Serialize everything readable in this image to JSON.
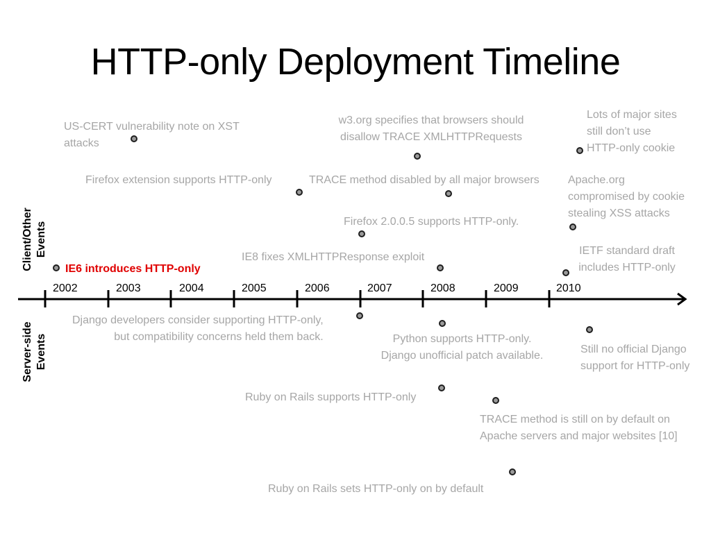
{
  "title": "HTTP-only Deployment Timeline",
  "side_labels": {
    "top": [
      "Client/Other",
      "Events"
    ],
    "bottom": [
      "Server-side",
      "Events"
    ]
  },
  "axis": {
    "years": [
      "2002",
      "2003",
      "2004",
      "2005",
      "2006",
      "2007",
      "2008",
      "2009",
      "2010"
    ]
  },
  "colors": {
    "highlight": "#e00000",
    "event_text": "#a6a6a6",
    "axis": "#000000"
  },
  "client_events": [
    {
      "text": [
        "US-CERT vulnerability note on XST",
        "attacks"
      ]
    },
    {
      "text": [
        "w3.org  specifies that browsers should",
        "disallow TRACE XMLHTTPRequests"
      ]
    },
    {
      "text": [
        "Lots of major sites",
        "still don’t use",
        "HTTP-only cookie"
      ]
    },
    {
      "text": [
        "Firefox extension supports HTTP-only"
      ]
    },
    {
      "text": [
        "TRACE method disabled by all major browsers"
      ]
    },
    {
      "text": [
        "Apache.org",
        "compromised by cookie",
        "stealing XSS attacks"
      ]
    },
    {
      "text": [
        "Firefox 2.0.0.5 supports HTTP-only."
      ]
    },
    {
      "text": [
        "IE8 fixes XMLHTTPResponse exploit"
      ]
    },
    {
      "text": [
        "IETF standard draft",
        "includes HTTP-only"
      ]
    },
    {
      "text": [
        "IE6 introduces HTTP-only"
      ],
      "highlight": true
    }
  ],
  "server_events": [
    {
      "text": [
        "Django developers consider supporting HTTP-only,",
        "but compatibility concerns held them back."
      ]
    },
    {
      "text": [
        "Python supports HTTP-only.",
        "Django unofficial patch available."
      ]
    },
    {
      "text": [
        "Still no official Django",
        "support for HTTP-only"
      ]
    },
    {
      "text": [
        "Ruby on Rails supports HTTP-only"
      ]
    },
    {
      "text": [
        "TRACE method is still on by default on",
        "Apache servers and major websites [10]"
      ]
    },
    {
      "text": [
        "Ruby on Rails sets  HTTP-only on by default"
      ]
    }
  ]
}
